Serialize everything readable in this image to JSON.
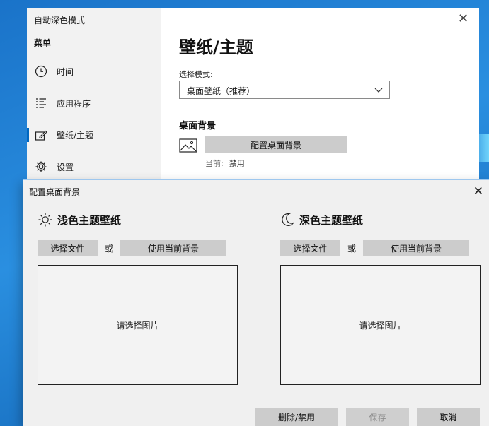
{
  "main_window": {
    "app_title": "自动深色模式",
    "menu_title": "菜单",
    "nav": [
      {
        "label": "时间",
        "icon": "clock-icon"
      },
      {
        "label": "应用程序",
        "icon": "list-icon"
      },
      {
        "label": "壁纸/主题",
        "icon": "edit-icon",
        "selected": true
      },
      {
        "label": "设置",
        "icon": "gear-icon"
      }
    ],
    "page_title": "壁纸/主题",
    "mode_label": "选择模式:",
    "mode_value": "桌面壁纸（推荐）",
    "section_title": "桌面背景",
    "config_button": "配置桌面背景",
    "current_label": "当前:",
    "current_value": "禁用"
  },
  "dialog": {
    "title": "配置桌面背景",
    "light": {
      "heading": "浅色主题壁纸",
      "choose_file": "选择文件",
      "or": "或",
      "use_current": "使用当前背景",
      "placeholder": "请选择图片"
    },
    "dark": {
      "heading": "深色主题壁纸",
      "choose_file": "选择文件",
      "or": "或",
      "use_current": "使用当前背景",
      "placeholder": "请选择图片"
    },
    "footer": {
      "delete_disable": "删除/禁用",
      "save": "保存",
      "cancel": "取消"
    }
  },
  "colors": {
    "accent": "#0067c0",
    "button_gray": "#cccccc",
    "desktop_blue": "#1a73c9"
  }
}
